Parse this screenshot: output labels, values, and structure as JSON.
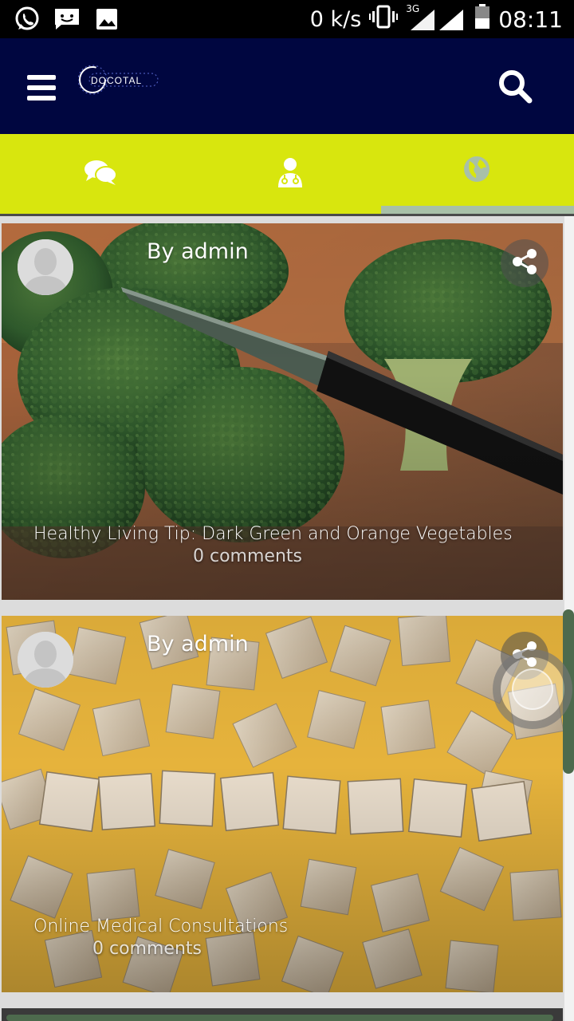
{
  "status_bar": {
    "speed": "0 k/s",
    "network": "3G",
    "time": "08:11",
    "icons": [
      "whatsapp-icon",
      "message-icon",
      "image-icon",
      "vibrate-icon",
      "signal-icon",
      "battery-icon"
    ]
  },
  "app_bar": {
    "logo_text": "DOCOTAL",
    "menu_icon": "hamburger-icon",
    "search_icon": "search-icon",
    "background": "#000640"
  },
  "tabs": [
    {
      "icon": "chat-bubbles-icon",
      "active": false
    },
    {
      "icon": "doctor-icon",
      "active": false
    },
    {
      "icon": "globe-icon",
      "active": true
    }
  ],
  "accent": "#d8e60e",
  "posts": [
    {
      "author": "By admin",
      "title": "Healthy Living Tip: Dark Green and Orange Vegetables",
      "comments": "0 comments",
      "image": "broccoli-with-knife"
    },
    {
      "author": "By admin",
      "title": "Online Medical Consultations",
      "comments": "0 comments",
      "image": "scrabble-tiles-internet"
    }
  ]
}
